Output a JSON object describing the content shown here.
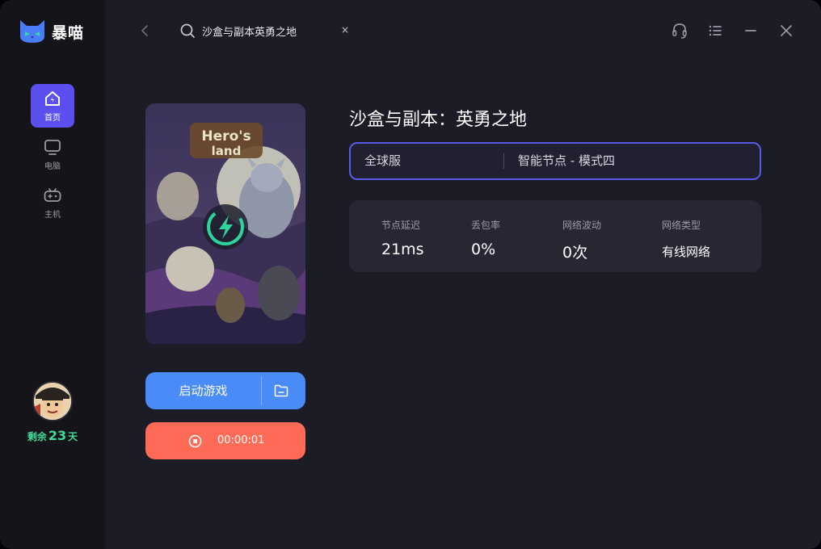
{
  "app": {
    "brand_name": "暴喵",
    "icons": [
      "cat-logo-icon",
      "back-arrow-icon",
      "search-icon",
      "close-icon",
      "headset-icon",
      "menu-list-icon",
      "minimize-icon",
      "window-close-icon",
      "folder-icon",
      "stop-icon",
      "lightning-icon"
    ]
  },
  "colors": {
    "accent": "#5b4ff0",
    "launch": "#4a8cf7",
    "stop": "#ff6b57",
    "remaining": "#3ddc97",
    "brand_green": "#35d6a0"
  },
  "sidebar": {
    "items": [
      {
        "label": "首页",
        "icon": "home-icon",
        "active": true
      },
      {
        "label": "电脑",
        "icon": "monitor-icon",
        "active": false
      },
      {
        "label": "主机",
        "icon": "gamepad-icon",
        "active": false
      }
    ],
    "remaining_prefix": "剩余",
    "remaining_days": "23",
    "remaining_suffix": "天"
  },
  "search": {
    "value": "沙盒与副本英勇之地",
    "clear_label": "×"
  },
  "game": {
    "title": "沙盒与副本：英勇之地",
    "launch_label": "启动游戏",
    "elapsed": "00:00:01"
  },
  "server": {
    "region": "全球服",
    "node": "智能节点 - 模式四"
  },
  "stats": [
    {
      "label": "节点延迟",
      "value": "21ms"
    },
    {
      "label": "丢包率",
      "value": "0%"
    },
    {
      "label": "网络波动",
      "value": "0次"
    },
    {
      "label": "网络类型",
      "value": "有线网络"
    }
  ]
}
